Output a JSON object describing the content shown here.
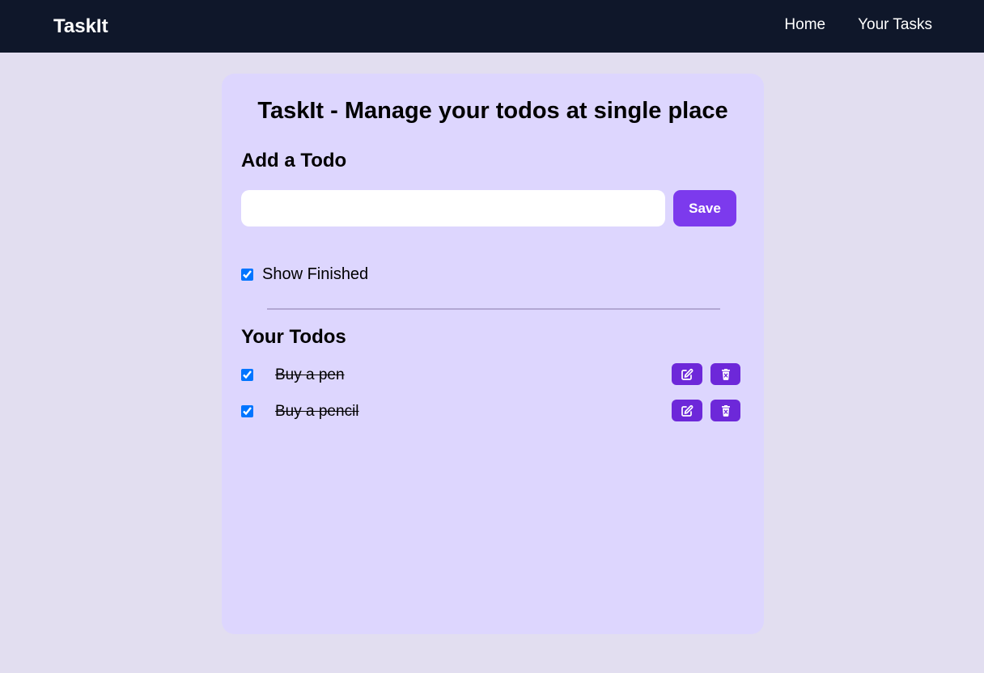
{
  "navbar": {
    "brand": "TaskIt",
    "links": [
      "Home",
      "Your Tasks"
    ]
  },
  "main": {
    "title": "TaskIt - Manage your todos at single place",
    "add_heading": "Add a Todo",
    "input": {
      "value": "",
      "placeholder": ""
    },
    "save_label": "Save",
    "show_finished": {
      "label": "Show Finished",
      "checked": true
    },
    "todos_heading": "Your Todos",
    "todos": [
      {
        "text": "Buy a pen",
        "done": true
      },
      {
        "text": "Buy a pencil",
        "done": true
      }
    ],
    "todo_actions": {
      "edit_icon": "edit-icon",
      "delete_icon": "trash-icon"
    }
  },
  "colors": {
    "navbar_bg": "#0f172a",
    "page_bg": "#e2def0",
    "card_bg": "#ddd6fe",
    "save_button": "#7c3aed",
    "action_button": "#6d28d9",
    "checkbox": "#0075ff"
  }
}
